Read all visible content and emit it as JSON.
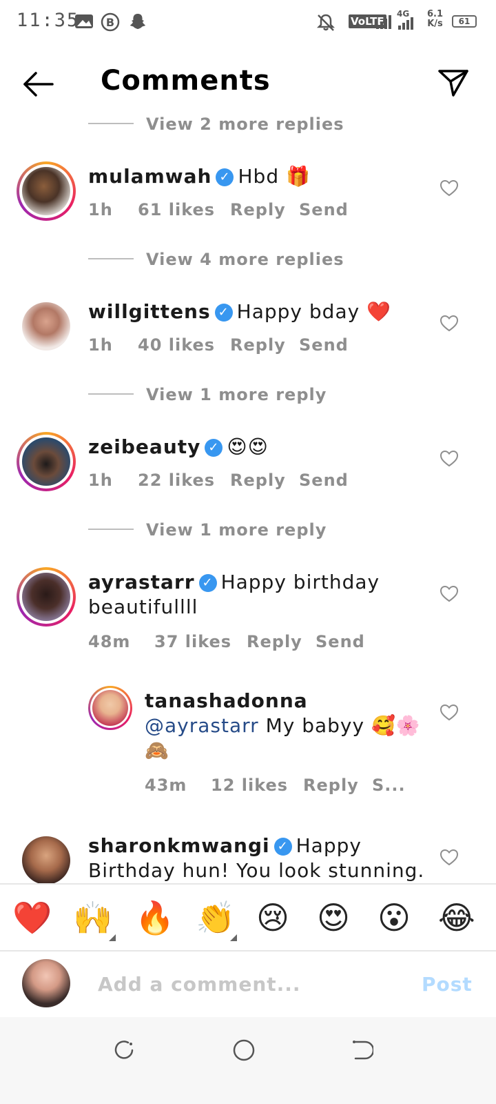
{
  "status_bar": {
    "time": "11:35",
    "volte": "VoLTE",
    "network": "4G",
    "speed_value": "6.1",
    "speed_unit": "K/s",
    "battery": "61"
  },
  "header": {
    "title": "Comments"
  },
  "comments": [
    {
      "view_replies": "View 2 more replies",
      "username": "mulamwah",
      "text": "Hbd 🎁",
      "time": "1h",
      "likes": "61 likes",
      "reply": "Reply",
      "send": "Send"
    },
    {
      "view_replies": "View 4 more replies",
      "username": "willgittens",
      "text": "Happy bday ❤️",
      "time": "1h",
      "likes": "40 likes",
      "reply": "Reply",
      "send": "Send"
    },
    {
      "view_replies": "View 1 more reply",
      "username": "zeibeauty",
      "text": "😍😍",
      "time": "1h",
      "likes": "22 likes",
      "reply": "Reply",
      "send": "Send"
    },
    {
      "view_replies": "View 1 more reply",
      "username": "ayrastarr",
      "text_line1": "Happy birthday",
      "text_line2": "beautifullll",
      "time": "48m",
      "likes": "37 likes",
      "reply": "Reply",
      "send": "Send"
    },
    {
      "username": "tanashadonna",
      "mention": "@ayrastarr",
      "text_line1": "My babyy 🥰🌸",
      "text_line2": "🙈",
      "time": "43m",
      "likes": "12 likes",
      "reply": "Reply",
      "send": "S..."
    },
    {
      "username": "sharonkmwangi",
      "text_line1": "Happy",
      "text_line2": "Birthday hun! You look stunning."
    }
  ],
  "emoji_bar": [
    "❤️",
    "🙌",
    "🔥",
    "👏",
    "😢",
    "😍",
    "😮",
    "😂"
  ],
  "add_comment": {
    "placeholder": "Add a comment...",
    "post": "Post"
  },
  "colors": {
    "verified": "#3897f0",
    "post_disabled": "#b3dbff",
    "mention": "#264b88",
    "muted": "#8e8e8e"
  }
}
